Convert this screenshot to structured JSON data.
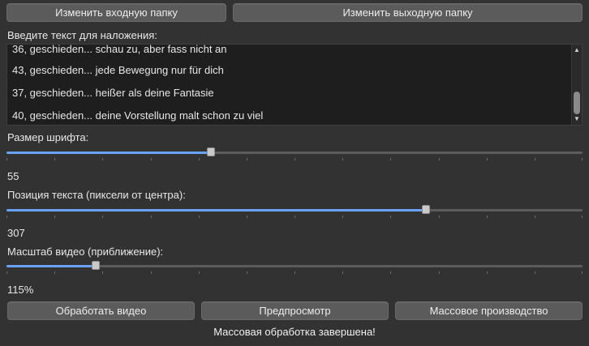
{
  "buttons": {
    "input_folder": "Изменить входную папку",
    "output_folder": "Изменить выходную папку",
    "process_video": "Обработать видео",
    "preview": "Предпросмотр",
    "mass_production": "Массовое производство"
  },
  "overlay": {
    "label": "Введите текст для наложения:",
    "lines": [
      "36, geschieden... schau zu, aber fass nicht an",
      "43, geschieden... jede Bewegung nur für dich",
      "37, geschieden... heißer als deine Fantasie",
      "40, geschieden... deine Vorstellung malt schon zu viel"
    ]
  },
  "font_size": {
    "label": "Размер шрифта:",
    "value": "55",
    "fraction": 0.355
  },
  "text_position": {
    "label": "Позиция текста (пиксели от центра):",
    "value": "307",
    "fraction": 0.728
  },
  "video_scale": {
    "label": "Масштаб видео (приближение):",
    "value": "115%",
    "fraction": 0.155
  },
  "status": "Массовая обработка завершена!",
  "colors": {
    "accent": "#6aa3f5",
    "background": "#323232",
    "textbox": "#1e1e1e"
  },
  "icons": {
    "scroll_up": "triangle-up-icon",
    "scroll_down": "triangle-down-icon"
  }
}
